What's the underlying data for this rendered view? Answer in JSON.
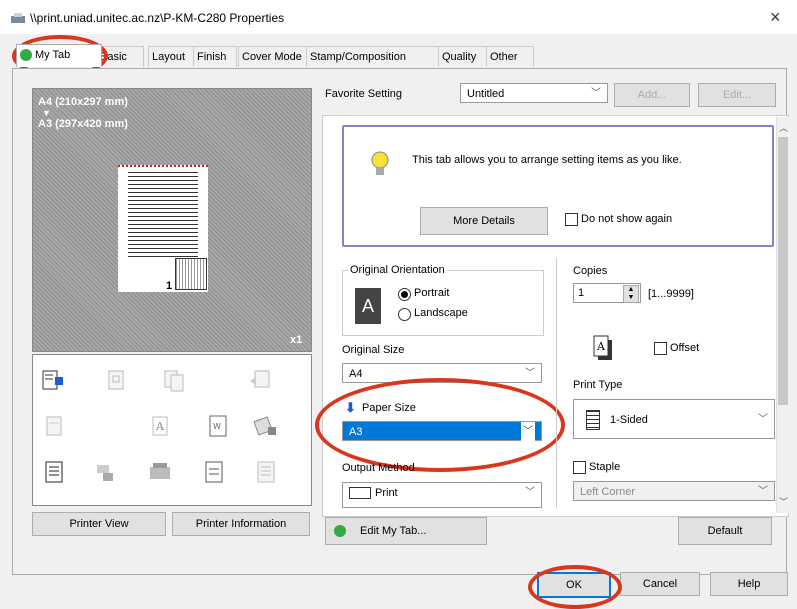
{
  "window": {
    "title": "\\\\print.uniad.unitec.ac.nz\\P-KM-C280 Properties",
    "close": "×"
  },
  "tabs": [
    {
      "label": "My Tab",
      "active": true
    },
    {
      "label": "Basic"
    },
    {
      "label": "Layout"
    },
    {
      "label": "Finish"
    },
    {
      "label": "Cover Mode"
    },
    {
      "label": "Stamp/Composition"
    },
    {
      "label": "Quality"
    },
    {
      "label": "Other"
    }
  ],
  "preview": {
    "original_size": "A4 (210x297 mm)",
    "arrow": "▼",
    "output_size": "A3 (297x420 mm)",
    "copies_marker": "x1",
    "page_number": "1"
  },
  "left_buttons": {
    "printer_view": "Printer View",
    "printer_information": "Printer Information"
  },
  "favorite": {
    "label": "Favorite Setting",
    "value": "Untitled",
    "add": "Add...",
    "edit": "Edit..."
  },
  "info": {
    "message": "This tab allows you to arrange setting items as you like.",
    "more_details": "More Details",
    "do_not_show": "Do not show again"
  },
  "orientation": {
    "label": "Original Orientation",
    "icon_letter": "A",
    "portrait": "Portrait",
    "landscape": "Landscape",
    "selected": "Portrait"
  },
  "original_size": {
    "label": "Original Size",
    "value": "A4"
  },
  "paper_size": {
    "label": "Paper Size",
    "value": "A3"
  },
  "output_method": {
    "label": "Output Method",
    "value": "Print"
  },
  "copies": {
    "label": "Copies",
    "value": "1",
    "range": "[1...9999]"
  },
  "offset": {
    "label": "Offset"
  },
  "print_type": {
    "label": "Print Type",
    "value": "1-Sided"
  },
  "staple": {
    "label": "Staple",
    "value": "Left Corner"
  },
  "bottom_buttons": {
    "edit_my_tab": "Edit My Tab...",
    "default": "Default",
    "ok": "OK",
    "cancel": "Cancel",
    "help": "Help"
  },
  "colors": {
    "annotation": "#d9361e",
    "highlight": "#0078d7",
    "info_border": "#8a7fc8"
  }
}
